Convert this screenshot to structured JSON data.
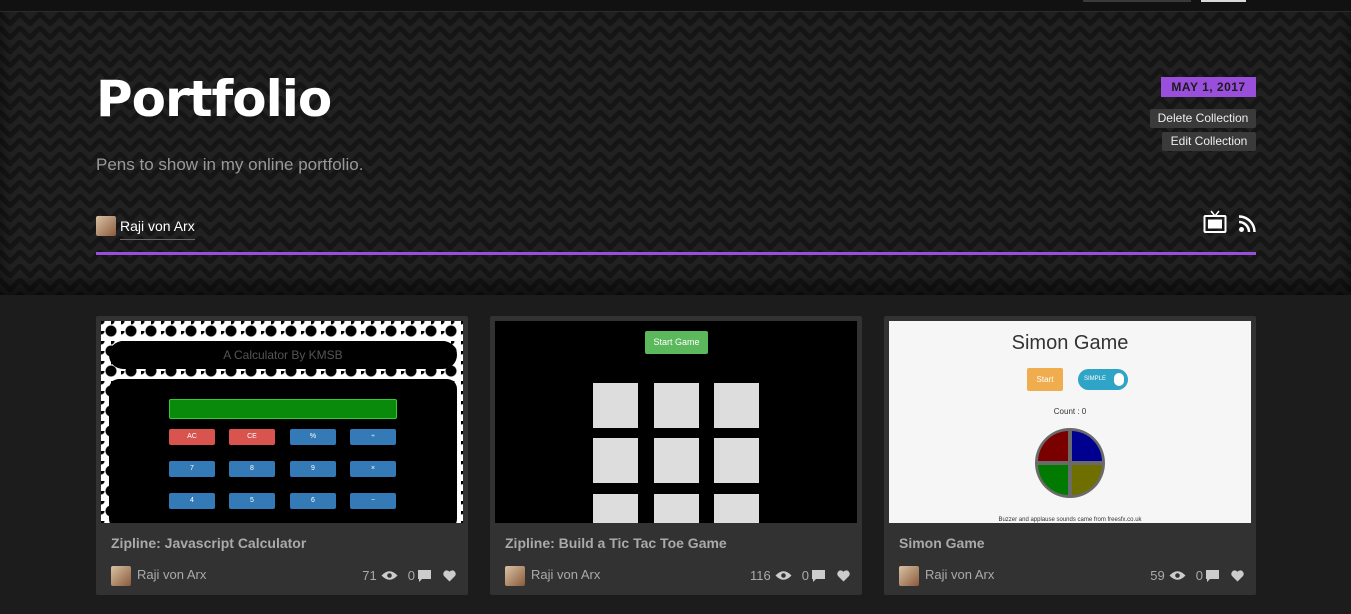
{
  "header": {
    "title": "Portfolio",
    "description": "Pens to show in my online portfolio.",
    "date": "MAY 1, 2017",
    "delete_label": "Delete Collection",
    "edit_label": "Edit Collection",
    "owner": "Raji von Arx",
    "accent": "#9a4fdc",
    "icons": [
      "tv-icon",
      "rss-icon"
    ]
  },
  "cards": [
    {
      "title": "Zipline: Javascript Calculator",
      "author": "Raji von Arx",
      "views": "71",
      "comments": "0",
      "preview": {
        "heading": "A Calculator By KMSB",
        "keys": [
          "AC",
          "CE",
          "%",
          "÷",
          "7",
          "8",
          "9",
          "×",
          "4",
          "5",
          "6",
          "−"
        ]
      }
    },
    {
      "title": "Zipline: Build a Tic Tac Toe Game",
      "author": "Raji von Arx",
      "views": "116",
      "comments": "0",
      "preview": {
        "button": "Start Game"
      }
    },
    {
      "title": "Simon Game",
      "author": "Raji von Arx",
      "views": "59",
      "comments": "0",
      "preview": {
        "heading": "Simon Game",
        "start": "Start",
        "mode": "SIMPLE",
        "count": "Count : 0",
        "footer": "Buzzer and applause sounds came from freesfx.co.uk"
      }
    }
  ]
}
